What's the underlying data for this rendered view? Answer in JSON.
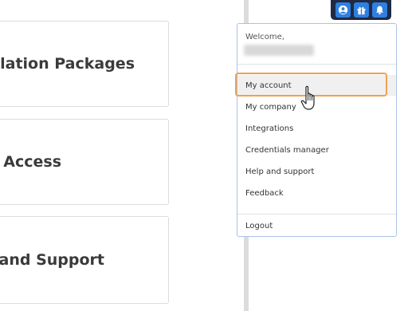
{
  "cards": [
    {
      "title": "llation Packages"
    },
    {
      "title": "y Access"
    },
    {
      "title": "and Support"
    }
  ],
  "topbar": {
    "icons": [
      "user-circle-icon",
      "gift-icon",
      "bell-icon"
    ]
  },
  "menu": {
    "welcome": "Welcome,",
    "items": [
      {
        "label": "My account"
      },
      {
        "label": "My company"
      },
      {
        "label": "Integrations"
      },
      {
        "label": "Credentials manager"
      },
      {
        "label": "Help and support"
      },
      {
        "label": "Feedback"
      }
    ],
    "logout": "Logout"
  },
  "colors": {
    "accent": "#2f7fe0",
    "topbar_bg": "#1f2a44",
    "highlight": "#f0a050"
  }
}
